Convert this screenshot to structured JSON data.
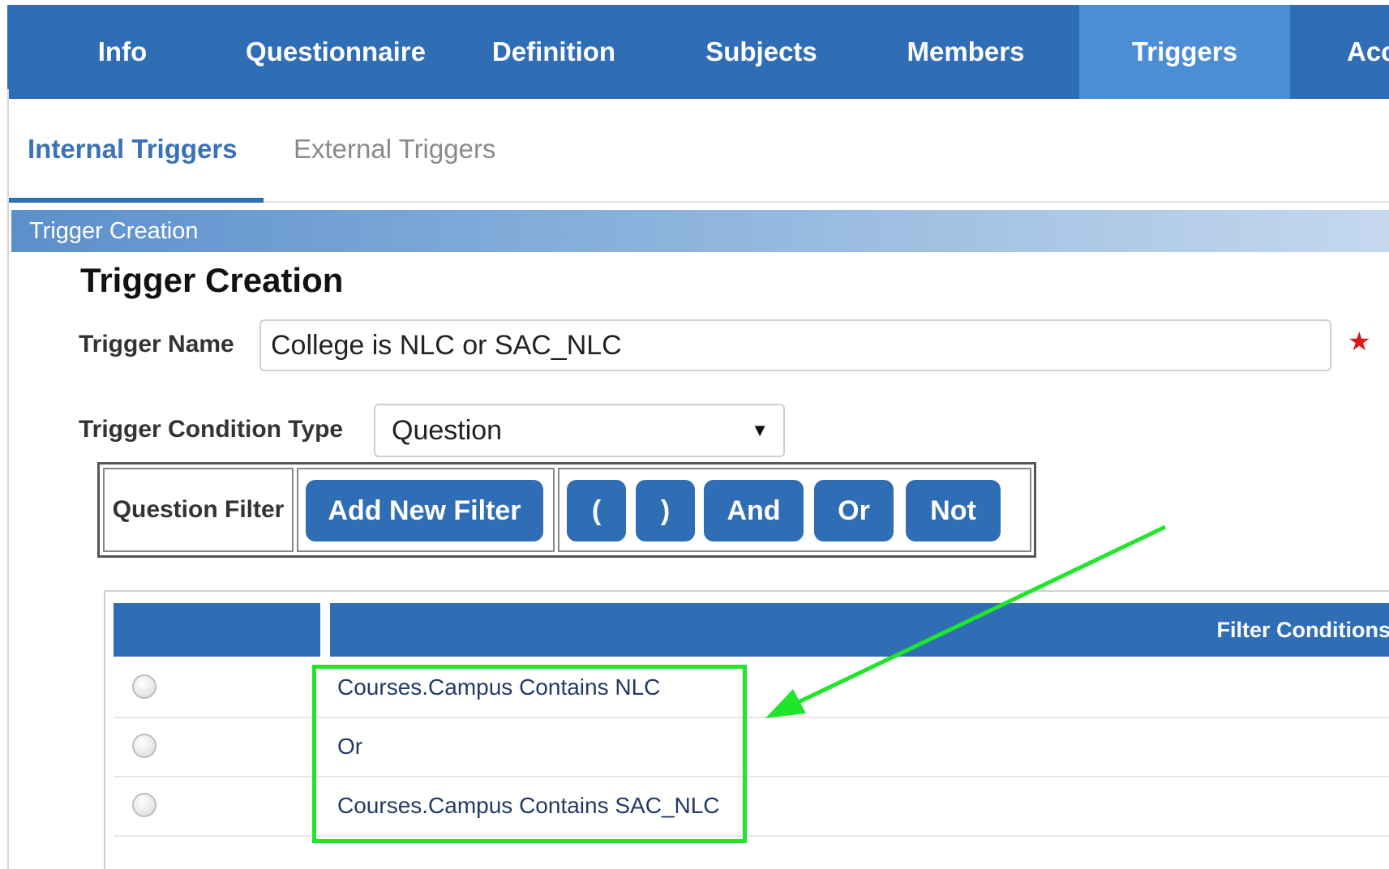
{
  "top_nav": {
    "tabs": [
      {
        "label": "Info"
      },
      {
        "label": "Questionnaire"
      },
      {
        "label": "Definition"
      },
      {
        "label": "Subjects"
      },
      {
        "label": "Members"
      },
      {
        "label": "Triggers",
        "active": true
      },
      {
        "label": "Acc"
      }
    ]
  },
  "sub_tabs": [
    {
      "label": "Internal Triggers",
      "active": true
    },
    {
      "label": "External Triggers"
    }
  ],
  "section_bar": {
    "title": "Trigger Creation"
  },
  "form": {
    "title": "Trigger Creation",
    "trigger_name_label": "Trigger Name",
    "trigger_name_value": "College is NLC or SAC_NLC",
    "required_marker": "★",
    "condition_type_label": "Trigger Condition Type",
    "condition_type_value": "Question",
    "dropdown_arrow": "▼"
  },
  "filter_toolbar": {
    "label": "Question Filter",
    "add_button": "Add New Filter",
    "operators": [
      "(",
      ")",
      "And",
      "Or",
      "Not"
    ]
  },
  "filter_table": {
    "header": "Filter Conditions",
    "rows": [
      "Courses.Campus Contains NLC",
      "Or",
      "Courses.Campus Contains SAC_NLC"
    ]
  },
  "colors": {
    "nav": "#2f6db5",
    "nav_active": "#4b8ed4",
    "annotation_green": "#1fe62a",
    "required_red": "#d9191c"
  }
}
